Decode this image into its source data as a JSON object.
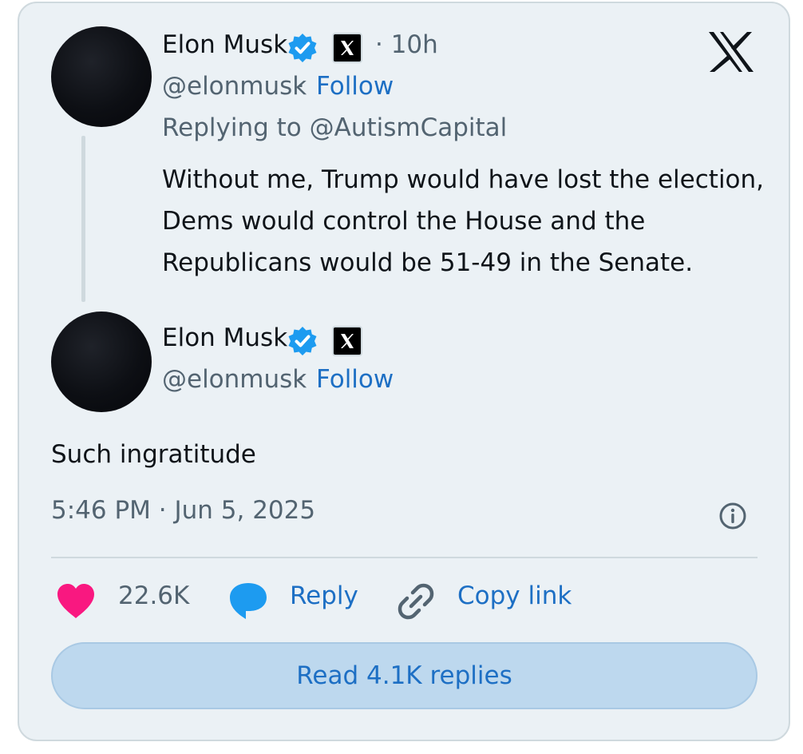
{
  "brand": {
    "logo": "X"
  },
  "parent_tweet": {
    "author_name": "Elon Musk",
    "time_ago": "· 10h",
    "handle": "@elonmusk",
    "dot": "·",
    "follow_label": "Follow",
    "replying_to": "Replying to @AutismCapital",
    "text_lines": [
      "Without me, Trump would have lost the election,",
      "Dems would control the House and the",
      "Republicans would be 51-49 in the Senate."
    ]
  },
  "reply_tweet": {
    "author_name": "Elon Musk",
    "handle": "@elonmusk",
    "dot": "·",
    "follow_label": "Follow",
    "text": "Such ingratitude",
    "timestamp": "5:46 PM · Jun 5, 2025"
  },
  "actions": {
    "likes": "22.6K",
    "reply_label": "Reply",
    "copy_link_label": "Copy link"
  },
  "read_replies_label": "Read 4.1K replies",
  "icons": {
    "verified": "verified-badge-icon",
    "x_affiliate": "x-affiliate-icon",
    "info": "info-icon",
    "heart": "heart-icon",
    "reply": "reply-bubble-icon",
    "link": "link-icon"
  },
  "colors": {
    "card_bg": "#ebf1f5",
    "verified": "#1d9bf0",
    "heart": "#f91880",
    "link_blue": "#1d6fc4",
    "button_bg": "#bdd8ee"
  }
}
